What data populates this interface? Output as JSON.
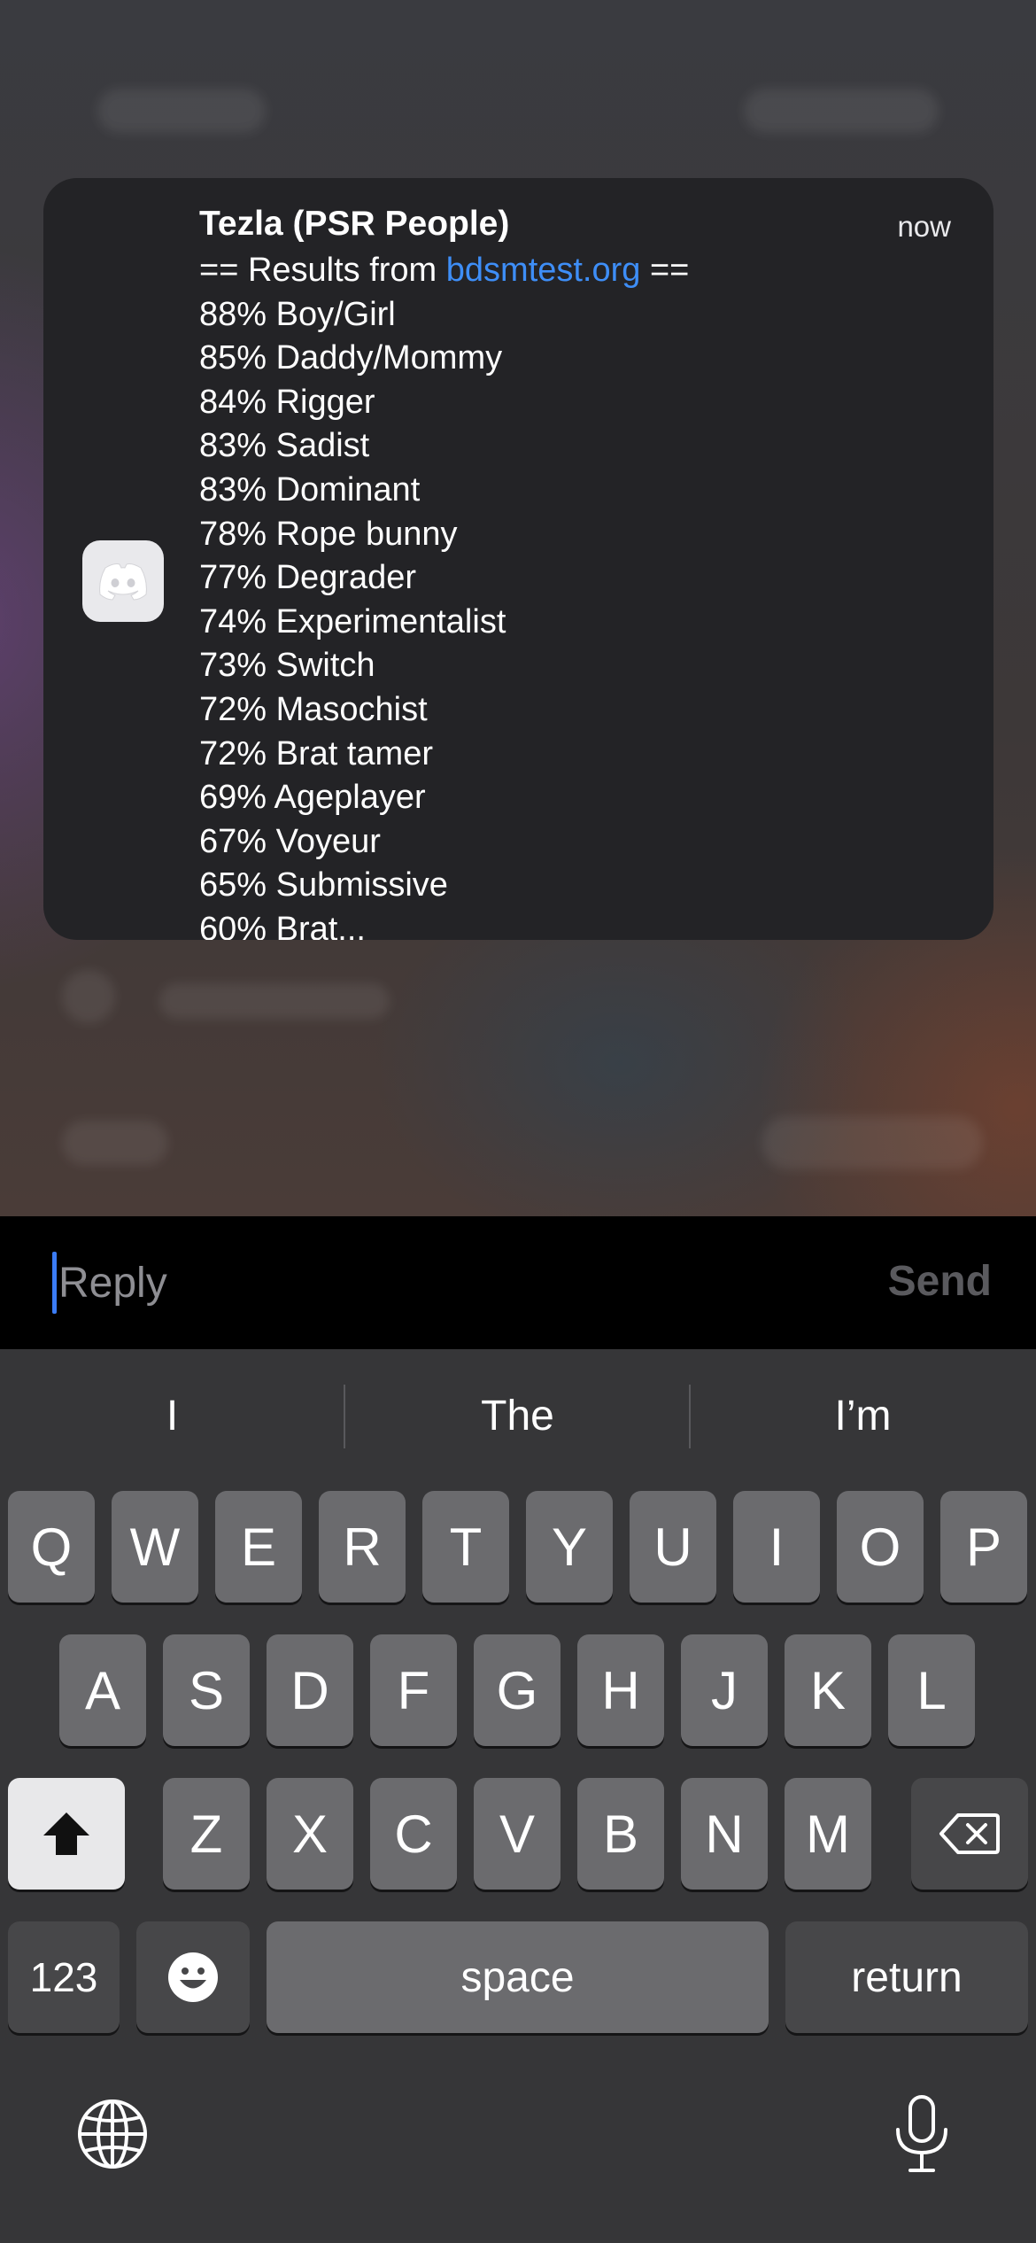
{
  "notification": {
    "sender": "Tezla (PSR People)",
    "time": "now",
    "app_icon": "discord-icon",
    "header_prefix": "== Results from ",
    "header_link": "bdsmtest.org",
    "header_suffix": " ==",
    "lines": [
      "88% Boy/Girl",
      "85% Daddy/Mommy",
      "84% Rigger",
      "83% Sadist",
      "83% Dominant",
      "78% Rope bunny",
      "77% Degrader",
      "74% Experimentalist",
      "73% Switch",
      "72% Masochist",
      "72% Brat tamer",
      "69% Ageplayer",
      "67% Voyeur",
      "65% Submissive",
      "60% Brat..."
    ]
  },
  "reply": {
    "placeholder": "Reply",
    "send_label": "Send"
  },
  "keyboard": {
    "suggestions": [
      "I",
      "The",
      "I’m"
    ],
    "row1": [
      "Q",
      "W",
      "E",
      "R",
      "T",
      "Y",
      "U",
      "I",
      "O",
      "P"
    ],
    "row2": [
      "A",
      "S",
      "D",
      "F",
      "G",
      "H",
      "J",
      "K",
      "L"
    ],
    "row3": [
      "Z",
      "X",
      "C",
      "V",
      "B",
      "N",
      "M"
    ],
    "numbers_label": "123",
    "space_label": "space",
    "return_label": "return",
    "icons": [
      "shift-icon",
      "delete-icon",
      "emoji-icon",
      "globe-icon",
      "microphone-icon"
    ]
  },
  "colors": {
    "accent_link": "#3e8ef7",
    "cursor": "#3b7cf5",
    "notification_bg": "#232326",
    "keyboard_bg": "#363638"
  }
}
